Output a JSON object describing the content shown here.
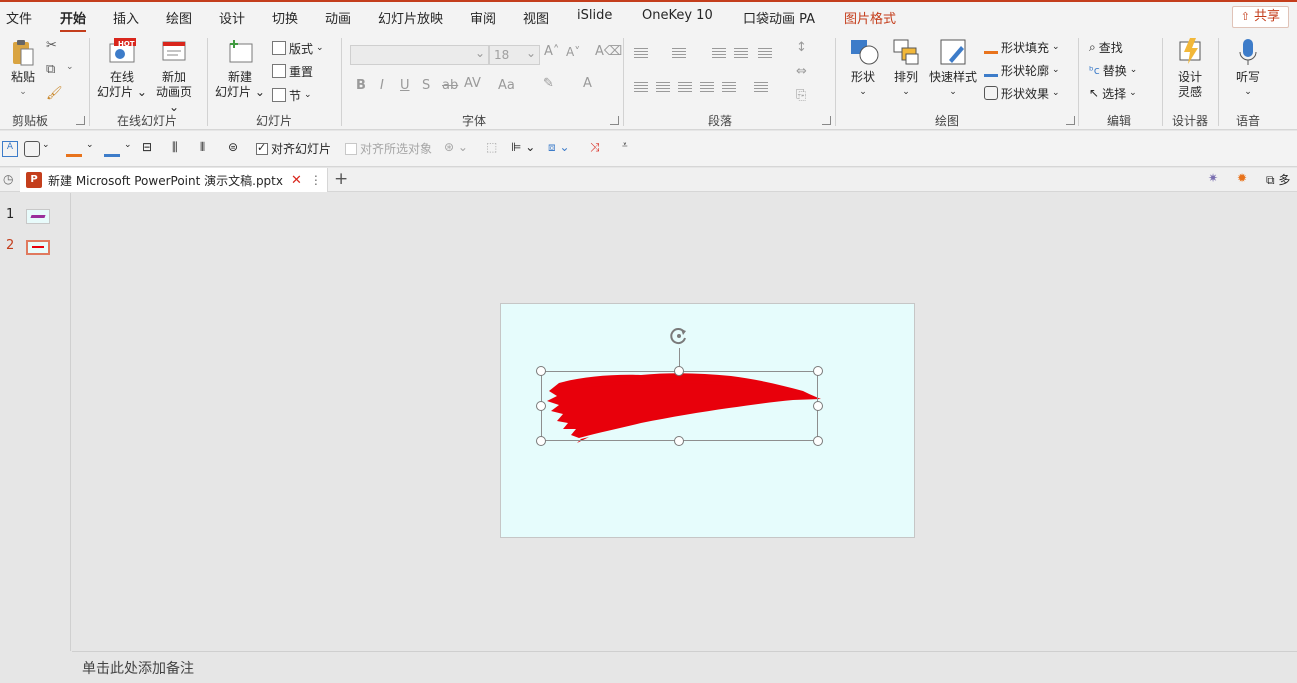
{
  "menu": {
    "tabs": [
      "文件",
      "开始",
      "插入",
      "绘图",
      "设计",
      "切换",
      "动画",
      "幻灯片放映",
      "审阅",
      "视图",
      "iSlide",
      "OneKey 10",
      "口袋动画 PA",
      "图片格式"
    ],
    "share": "共享"
  },
  "ribbon": {
    "clipboard": {
      "label": "剪贴板",
      "paste": "粘贴"
    },
    "online": {
      "label": "在线幻灯片",
      "btn1_line1": "在线",
      "btn1_line2": "幻灯片",
      "btn2_line1": "新加",
      "btn2_line2": "动画页",
      "badge": "HOT"
    },
    "slides": {
      "label": "幻灯片",
      "new_line1": "新建",
      "new_line2": "幻灯片",
      "layout": "版式",
      "reset": "重置",
      "section": "节"
    },
    "font": {
      "label": "字体",
      "size": "18"
    },
    "paragraph": {
      "label": "段落"
    },
    "drawing": {
      "label": "绘图",
      "shapes": "形状",
      "arrange": "排列",
      "quick_styles": "快速样式",
      "fill": "形状填充",
      "outline": "形状轮廓",
      "effects": "形状效果"
    },
    "editing": {
      "label": "编辑",
      "find": "查找",
      "replace": "替换",
      "select": "选择"
    },
    "designer": {
      "label": "设计器",
      "btn_line1": "设计",
      "btn_line2": "灵感"
    },
    "voice": {
      "label": "语音",
      "btn": "听写"
    }
  },
  "qat": {
    "align_slide": "对齐幻灯片",
    "align_selected": "对齐所选对象"
  },
  "doc_tab": {
    "title": "新建 Microsoft PowerPoint 演示文稿.pptx"
  },
  "tabbar_right": {
    "multi": "多"
  },
  "slides": [
    {
      "num": "1"
    },
    {
      "num": "2"
    }
  ],
  "notes": {
    "placeholder": "单击此处添加备注"
  },
  "colors": {
    "accent": "#c43e1c",
    "slide_bg": "#e6fcfc",
    "brush": "#e8000b"
  }
}
